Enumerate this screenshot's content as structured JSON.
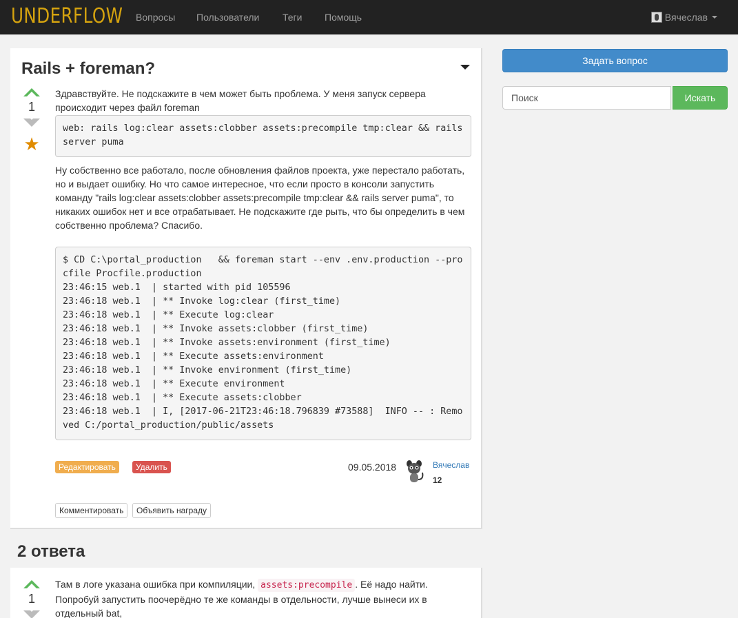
{
  "navbar": {
    "brand": "UNDERFLOW",
    "links": [
      "Вопросы",
      "Пользователи",
      "Теги",
      "Помощь"
    ],
    "user": "Вячеслав",
    "colors": {
      "background": "#222222",
      "brand": "#d4a20f"
    }
  },
  "question": {
    "title": "Rails + foreman?",
    "score": "1",
    "intro": "Здравствуйте. Не подскажите в чем может быть проблема. У меня запуск сервера происходит через файл foreman",
    "code1": "web: rails log:clear assets:clobber assets:precompile tmp:clear && rails server puma",
    "body": "Ну собственно все работало, после обновления файлов проекта, уже перестало работать, но и выдает ошибку. Но что самое интересное, что если просто в консоли запустить команду \"rails log:clear assets:clobber assets:precompile tmp:clear && rails server puma\", то никаких ошибок нет и все отрабатывает. Не подскажите где рыть, что бы определить в чем собственно проблема? Спасибо.",
    "code2": "$ CD C:\\portal_production   && foreman start --env .env.production --procfile Procfile.production\n23:46:15 web.1  | started with pid 105596\n23:46:18 web.1  | ** Invoke log:clear (first_time)\n23:46:18 web.1  | ** Execute log:clear\n23:46:18 web.1  | ** Invoke assets:clobber (first_time)\n23:46:18 web.1  | ** Invoke assets:environment (first_time)\n23:46:18 web.1  | ** Execute assets:environment\n23:46:18 web.1  | ** Invoke environment (first_time)\n23:46:18 web.1  | ** Execute environment\n23:46:18 web.1  | ** Execute assets:clobber\n23:46:18 web.1  | I, [2017-06-21T23:46:18.796839 #73588]  INFO -- : Removed C:/portal_production/public/assets",
    "edit_label": "Редактировать",
    "delete_label": "Удалить",
    "date": "09.05.2018",
    "author": "Вячеслав",
    "author_rep": "12",
    "comment_label": "Комментировать",
    "bounty_label": "Объявить награду"
  },
  "answers": {
    "heading": "2 ответа",
    "first": {
      "score": "1",
      "text_before": "Там в логе указана ошибка при компиляции, ",
      "code": "assets:precompile",
      "text_after": ". Её надо найти. Попробуй запустить поочерёдно те же команды в отдельности, лучше вынеси их в отдельный bat,"
    }
  },
  "sidebar": {
    "ask_label": "Задать вопрос",
    "search_placeholder": "Поиск",
    "search_button": "Искать"
  }
}
